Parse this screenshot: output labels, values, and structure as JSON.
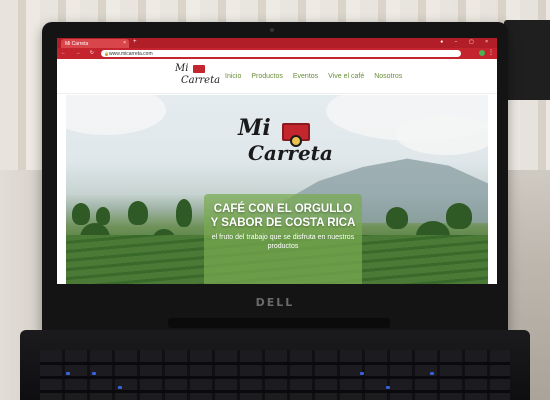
{
  "browser": {
    "tab_title": "Mi Carreta",
    "tab_close": "×",
    "new_tab": "+",
    "window_controls": "● − ▢ ×",
    "nav_buttons": "← → ↻ ⌂",
    "url": "www.micarreta.com",
    "menu": "⋮"
  },
  "site": {
    "logo_text_mi": "Mi",
    "logo_text_carreta": "Carreta",
    "nav": {
      "inicio": "Inicio",
      "productos": "Productos",
      "eventos": "Eventos",
      "vive": "Vive el café",
      "nosotros": "Nosotros"
    }
  },
  "hero": {
    "logo_mi": "Mi",
    "logo_carreta": "Carreta",
    "headline": "CAFÉ CON EL ORGULLO Y SABOR DE COSTA RICA",
    "subheadline": "el fruto del trabajo que se disfruta en nuestros productos"
  },
  "device": {
    "brand": "DELL"
  },
  "colors": {
    "browser_red": "#c3242d",
    "nav_green": "#6a8e3a",
    "overlay_green": "#78aa50",
    "logo_red": "#c4262e"
  }
}
